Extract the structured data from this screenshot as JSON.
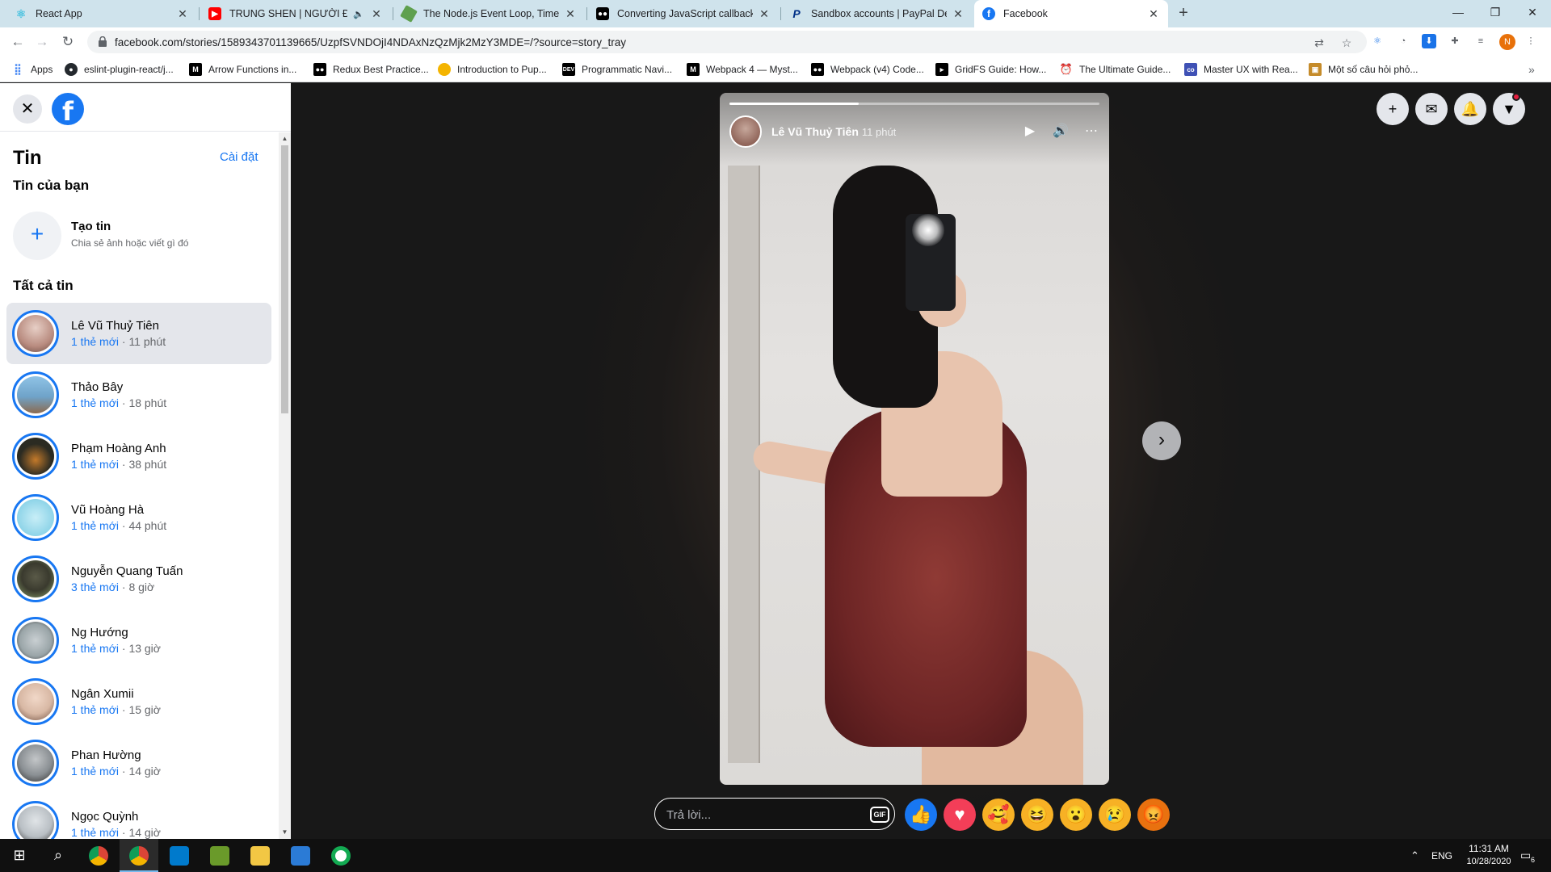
{
  "browser": {
    "tabs": [
      {
        "title": "React App",
        "icon": "react-icon",
        "color": "#61dafb"
      },
      {
        "title": "TRUNG SHEN | NGƯỜI ĐẦU",
        "icon": "youtube-icon",
        "color": "#ff0000"
      },
      {
        "title": "The Node.js Event Loop, Timers, a",
        "icon": "nodejs-icon",
        "color": "#5fa04e"
      },
      {
        "title": "Converting JavaScript callbacks to",
        "icon": "medium-icon",
        "color": "#000000"
      },
      {
        "title": "Sandbox accounts | PayPal Develop",
        "icon": "paypal-icon",
        "color": "#003087"
      },
      {
        "title": "Facebook",
        "icon": "facebook-icon",
        "color": "#1877f2"
      }
    ],
    "url": "facebook.com/stories/1589343701139665/UzpfSVNDOjI4NDAxNzQzMjk2MzY3MDE=/?source=story_tray",
    "profile_initial": "N",
    "bookmarks": [
      {
        "label": "Apps",
        "icon": "apps-grid-icon",
        "color": "#4285f4"
      },
      {
        "label": "eslint-plugin-react/j...",
        "icon": "github-icon",
        "color": "#24292e"
      },
      {
        "label": "Arrow Functions in...",
        "icon": "medium-icon",
        "color": "#000000"
      },
      {
        "label": "Redux Best Practice...",
        "icon": "medium-icon",
        "color": "#000000"
      },
      {
        "label": "Introduction to Pup...",
        "icon": "puppeteer-icon",
        "color": "#f4b400"
      },
      {
        "label": "Programmatic Navi...",
        "icon": "dev-icon",
        "color": "#000000"
      },
      {
        "label": "Webpack 4 — Myst...",
        "icon": "medium-icon",
        "color": "#000000"
      },
      {
        "label": "Webpack (v4) Code...",
        "icon": "medium-icon",
        "color": "#000000"
      },
      {
        "label": "GridFS Guide: How...",
        "icon": "bookmark-icon",
        "color": "#000000"
      },
      {
        "label": "The Ultimate Guide...",
        "icon": "clock-icon",
        "color": "#202124"
      },
      {
        "label": "Master UX with Rea...",
        "icon": "co-icon",
        "color": "#3f51b5"
      },
      {
        "label": "Một số câu hỏi phỏ...",
        "icon": "box-icon",
        "color": "#c58b2a"
      }
    ]
  },
  "stories_panel": {
    "title": "Tin",
    "settings": "Cài đặt",
    "your_story": "Tin của bạn",
    "create": {
      "title": "Tạo tin",
      "subtitle": "Chia sẻ ảnh hoặc viết gì đó"
    },
    "all_stories": "Tất cả tin",
    "items": [
      {
        "name": "Lê Vũ Thuỷ Tiên",
        "new_count": "1 thẻ mới",
        "time": "11 phút",
        "avatar_color": "#b98c80",
        "selected": true
      },
      {
        "name": "Thảo Bây",
        "new_count": "1 thẻ mới",
        "time": "18 phút",
        "avatar_color": "#6fa3c9",
        "selected": false
      },
      {
        "name": "Phạm Hoàng Anh",
        "new_count": "1 thẻ mới",
        "time": "38 phút",
        "avatar_color": "#2b2b22",
        "selected": false
      },
      {
        "name": "Vũ Hoàng Hà",
        "new_count": "1 thẻ mới",
        "time": "44 phút",
        "avatar_color": "#8ed4e8",
        "selected": false
      },
      {
        "name": "Nguyễn Quang Tuấn",
        "new_count": "3 thẻ mới",
        "time": "8 giờ",
        "avatar_color": "#3a3a2e",
        "selected": false
      },
      {
        "name": "Ng Hướng",
        "new_count": "1 thẻ mới",
        "time": "13 giờ",
        "avatar_color": "#9aa5a8",
        "selected": false
      },
      {
        "name": "Ngân Xumii",
        "new_count": "1 thẻ mới",
        "time": "15 giờ",
        "avatar_color": "#d8b8a4",
        "selected": false
      },
      {
        "name": "Phan Hường",
        "new_count": "1 thẻ mới",
        "time": "14 giờ",
        "avatar_color": "#8a8f93",
        "selected": false
      },
      {
        "name": "Ngọc Quỳnh",
        "new_count": "1 thẻ mới",
        "time": "14 giờ",
        "avatar_color": "#b9bfc4",
        "selected": false
      }
    ]
  },
  "viewer": {
    "author": "Lê Vũ Thuỷ Tiên",
    "time": "11 phút",
    "progress": 0.35,
    "reply_placeholder": "Trả lời...",
    "gif_label": "GIF",
    "reactions": [
      {
        "icon": "like-icon",
        "glyph": "👍",
        "color": "#1877f2"
      },
      {
        "icon": "love-icon",
        "glyph": "♥",
        "color": "#f33e58"
      },
      {
        "icon": "care-icon",
        "glyph": "🥰",
        "color": "#f7b125"
      },
      {
        "icon": "haha-icon",
        "glyph": "😆",
        "color": "#f7b125"
      },
      {
        "icon": "wow-icon",
        "glyph": "😮",
        "color": "#f7b125"
      },
      {
        "icon": "sad-icon",
        "glyph": "😢",
        "color": "#f7b125"
      },
      {
        "icon": "angry-icon",
        "glyph": "😡",
        "color": "#e9710f"
      }
    ]
  },
  "taskbar": {
    "language": "ENG",
    "time": "11:31 AM",
    "date": "10/28/2020",
    "notifications": "6"
  }
}
